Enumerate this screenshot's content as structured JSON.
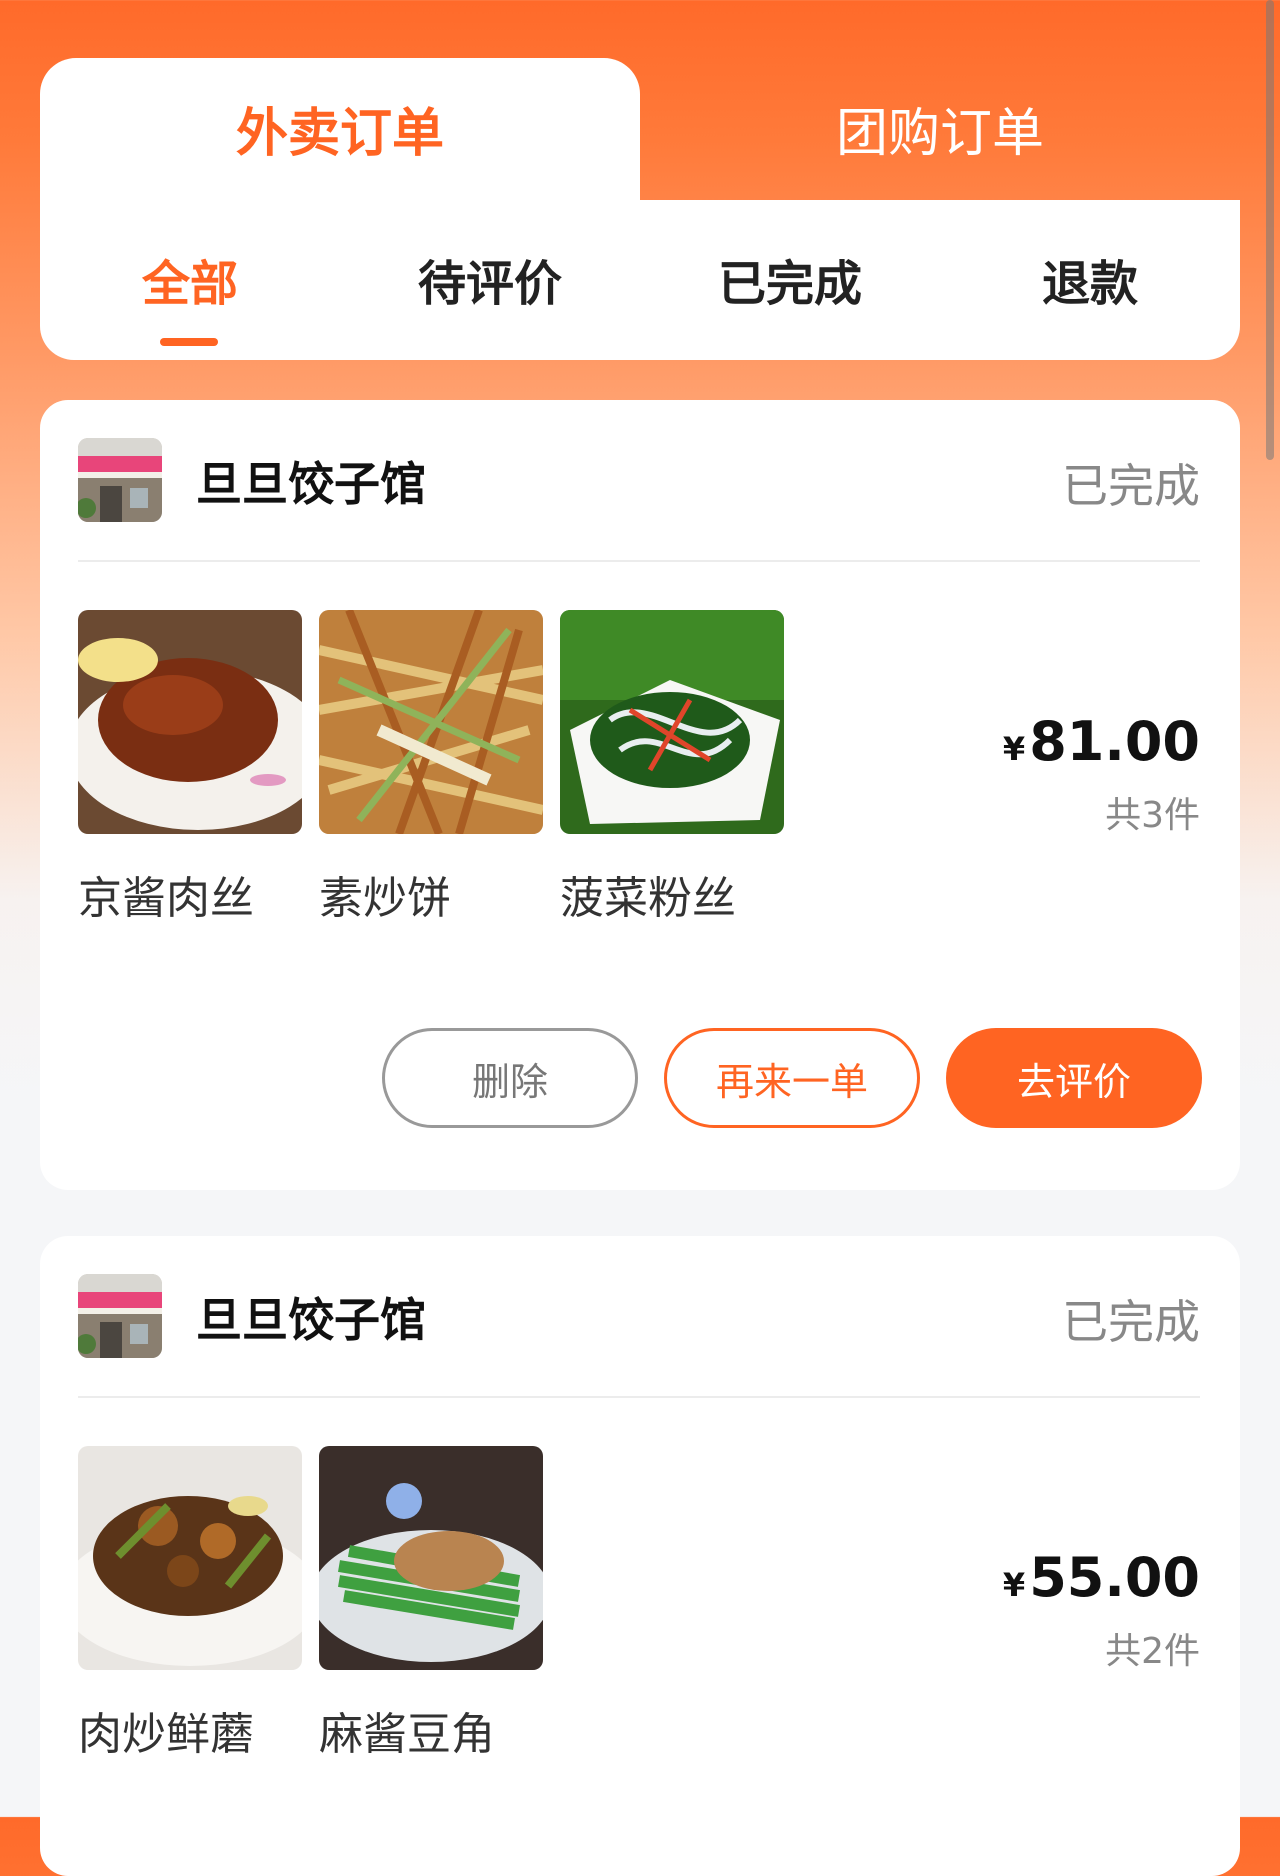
{
  "tabs": {
    "primary": [
      "外卖订单",
      "团购订单"
    ],
    "active_primary": "外卖订单"
  },
  "sub_tabs": {
    "items": [
      "全部",
      "待评价",
      "已完成",
      "退款"
    ],
    "active": "全部"
  },
  "colors": {
    "accent": "#ff6422",
    "status_text": "#888888"
  },
  "orders": [
    {
      "shop_name": "旦旦饺子馆",
      "status": "已完成",
      "dishes": [
        "京酱肉丝",
        "素炒饼",
        "菠菜粉丝"
      ],
      "currency": "¥",
      "price": "81.00",
      "count": "共3件",
      "actions": {
        "delete": "删除",
        "reorder": "再来一单",
        "review": "去评价"
      }
    },
    {
      "shop_name": "旦旦饺子馆",
      "status": "已完成",
      "dishes": [
        "肉炒鲜蘑",
        "麻酱豆角"
      ],
      "currency": "¥",
      "price": "55.00",
      "count": "共2件"
    }
  ]
}
